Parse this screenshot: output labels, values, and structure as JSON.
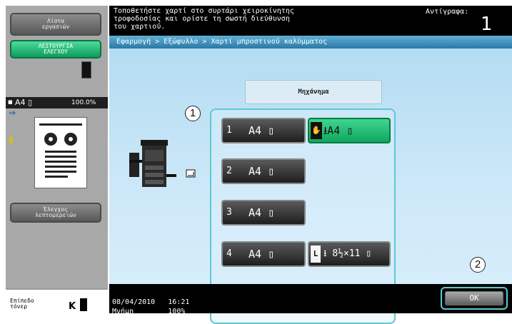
{
  "left_panel": {
    "job_list_label": "Λίστα\nεργασιών",
    "utility_label": "ΛΕΙΤΟΥΡΓΙΑ\nΕΛΕΓΧΟΥ",
    "paper_status": {
      "size": "A4 ▯",
      "zoom": "100.0%"
    },
    "finetune_label": "Έλεγχος\nλεπτομερειών",
    "toner_label": "Επίπεδο\nτόνερ",
    "toner_color": "K"
  },
  "message_bar": {
    "text": "Τοποθετήστε χαρτί στο συρτάρι χειροκίνητης\nτροφοδοσίας και ορίστε τη σωστή διεύθυνση\nτου χαρτιού.",
    "copies_label": "Αντίγραφα:",
    "copies_value": "1"
  },
  "breadcrumb": "Εφαρμογή > Εξώφυλλο > Χαρτί μπροστινού καλύμματος",
  "main": {
    "machine_header": "Μηχάνημα",
    "callout_1": "1",
    "callout_2": "2",
    "trays": [
      {
        "num": "1",
        "label": "A4 ▯"
      },
      {
        "num": "2",
        "label": "A4 ▯"
      },
      {
        "num": "3",
        "label": "A4 ▯"
      },
      {
        "num": "4",
        "label": "A4 ▯"
      }
    ],
    "bypass_tray": {
      "label": "⭳A4 ▯"
    },
    "lct_tray": {
      "key": "L",
      "label": "⭳ 8½×11 ▯"
    }
  },
  "bottom_bar": {
    "date": "08/04/2010",
    "time": "16:21",
    "memory_label": "Μνήμη",
    "memory_value": "100%",
    "ok_label": "OK"
  },
  "colors": {
    "breadcrumb_bg": "#3a8fbf",
    "selected_tray": "#1fc076",
    "callout_ring": "#5dc9d3"
  }
}
